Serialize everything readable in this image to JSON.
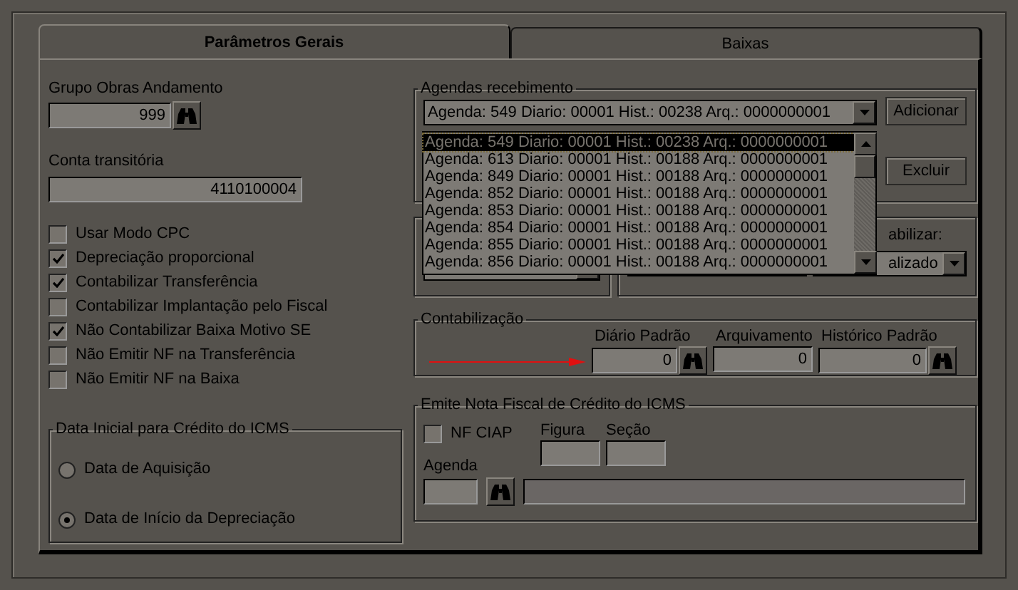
{
  "tabs": [
    {
      "label": "Parâmetros Gerais",
      "selected": true
    },
    {
      "label": "Baixas",
      "selected": false
    }
  ],
  "grupo_obras": {
    "label": "Grupo Obras Andamento",
    "value": "999"
  },
  "conta_transitoria": {
    "label": "Conta transitória",
    "value": "4110100004"
  },
  "options": [
    {
      "label": "Usar Modo CPC",
      "checked": false
    },
    {
      "label": "Depreciação proporcional",
      "checked": true
    },
    {
      "label": "Contabilizar Transferência",
      "checked": true
    },
    {
      "label": "Contabilizar Implantação pelo Fiscal",
      "checked": false
    },
    {
      "label": "Não Contabilizar Baixa Motivo SE",
      "checked": true
    },
    {
      "label": "Não Emitir NF na Transferência",
      "checked": false
    },
    {
      "label": "Não Emitir NF na Baixa",
      "checked": false
    }
  ],
  "data_inicial": {
    "title": "Data Inicial para Crédito do ICMS",
    "options": [
      {
        "label": "Data de Aquisição",
        "selected": false
      },
      {
        "label": "Data de Início da Depreciação",
        "selected": true
      }
    ]
  },
  "agendas": {
    "title": "Agendas recebimento",
    "value": "Agenda: 549 Diario: 00001 Hist.: 00238 Arq.: 0000000001",
    "buttons": [
      "Adicionar",
      "Excluir"
    ],
    "items": [
      {
        "text": "Agenda: 549 Diario: 00001 Hist.: 00238 Arq.: 0000000001",
        "selected": true
      },
      {
        "text": "Agenda: 613 Diario: 00001 Hist.: 00188 Arq.: 0000000001",
        "selected": false
      },
      {
        "text": "Agenda: 849 Diario: 00001 Hist.: 00188 Arq.: 0000000001",
        "selected": false
      },
      {
        "text": "Agenda: 852 Diario: 00001 Hist.: 00188 Arq.: 0000000001",
        "selected": false
      },
      {
        "text": "Agenda: 853 Diario: 00001 Hist.: 00188 Arq.: 0000000001",
        "selected": false
      },
      {
        "text": "Agenda: 854 Diario: 00001 Hist.: 00188 Arq.: 0000000001",
        "selected": false
      },
      {
        "text": "Agenda: 855 Diario: 00001 Hist.: 00188 Arq.: 0000000001",
        "selected": false
      },
      {
        "text": "Agenda: 856 Diario: 00001 Hist.: 00188 Arq.: 0000000001",
        "selected": false
      }
    ]
  },
  "middle": {
    "label": "abilizar:",
    "combo_value": "alizado"
  },
  "contabilizacao": {
    "title": "Contabilização",
    "fields": [
      {
        "label": "Diário Padrão",
        "value": "0",
        "lookup": true
      },
      {
        "label": "Arquivamento",
        "value": "0",
        "lookup": false
      },
      {
        "label": "Histórico Padrão",
        "value": "0",
        "lookup": true
      }
    ]
  },
  "emite": {
    "title": "Emite Nota Fiscal de Crédito do ICMS",
    "nf_ciap": {
      "label": "NF CIAP",
      "checked": false
    },
    "figura": "Figura",
    "secao": "Seção",
    "agenda": "Agenda"
  }
}
